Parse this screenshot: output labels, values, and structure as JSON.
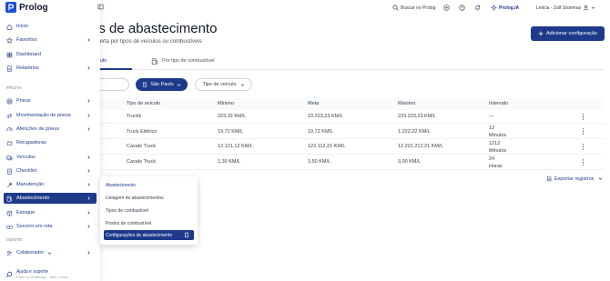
{
  "app": {
    "brand": "Prolog",
    "colors": {
      "primary": "#1e3a8a",
      "brand": "#1d4ed8",
      "text": "#1f2937",
      "muted": "#6b7280"
    }
  },
  "topbar": {
    "search_label": "Buscar no Prolog",
    "ia_label": "Prolog.IA",
    "user_label": "Leticia - Zalf Sistemas",
    "icons": [
      "search-icon",
      "add-circle-icon",
      "help-icon",
      "bell-icon",
      "sparkle-icon",
      "user-icon",
      "chevron-down-icon"
    ]
  },
  "sidebar": {
    "items_top": [
      {
        "label": "Início",
        "icon": "home-icon"
      },
      {
        "label": "Favoritos",
        "icon": "star-icon",
        "chevron": true
      },
      {
        "label": "Dashboard",
        "icon": "dashboard-icon"
      },
      {
        "label": "Relatórios",
        "icon": "report-icon",
        "chevron": true
      }
    ],
    "section_frota": "FROTA",
    "items_frota": [
      {
        "label": "Pneus",
        "icon": "tire-icon",
        "chevron": true
      },
      {
        "label": "Movimentação de pneus",
        "icon": "swap-icon",
        "chevron": true
      },
      {
        "label": "Aferições de pneus",
        "icon": "gauge-icon",
        "chevron": true
      },
      {
        "label": "Recapadoras",
        "icon": "recap-icon"
      },
      {
        "label": "Veículos",
        "icon": "truck-icon",
        "chevron": true
      },
      {
        "label": "Checklist",
        "icon": "checklist-icon",
        "chevron": true
      },
      {
        "label": "Manutenção",
        "icon": "wrench-icon",
        "chevron": true
      },
      {
        "label": "Abastecimento",
        "icon": "fuel-icon",
        "chevron": true,
        "active": true
      },
      {
        "label": "Estoque",
        "icon": "box-icon",
        "chevron": true
      },
      {
        "label": "Socorro em rota",
        "icon": "sos-icon",
        "chevron": true
      }
    ],
    "section_gente": "GENTE",
    "items_gente": [
      {
        "label": "Colaborador",
        "icon": "people-icon",
        "chevron": true
      }
    ],
    "help_title": "Ajuda e suporte",
    "help_sub": "Falar no whatsapp · Abrir o chat"
  },
  "flyout": {
    "heading": "Abastecimento",
    "items": [
      {
        "label": "Listagem de abastecimentos"
      },
      {
        "label": "Tipos de combustível"
      },
      {
        "label": "Postos de combustível"
      },
      {
        "label": "Configurações de abastecimento",
        "active": true
      }
    ]
  },
  "main": {
    "title": "es de abastecimento",
    "subtitle": "e alerta por tipos de veículos ou combustíveis",
    "add_button": "Adicionar configuração",
    "tabs": [
      "ulo",
      "Por tipo de combustível"
    ],
    "filters": {
      "unit": "São Paulo",
      "vehicle_type": "Tipo de veículo"
    },
    "table": {
      "headers": [
        "Tipo de veículo",
        "Mínimo",
        "Meta",
        "Máximo",
        "Intervalo"
      ],
      "rows": [
        [
          "Truckk",
          "223,32 KM/L",
          "23.223,23 KM/L",
          "233.223,23 KM/L",
          "---"
        ],
        [
          "Truck Elétrico",
          "19,72 KM/L",
          "19,72 KM/L",
          "1.222,22 KM/L",
          "12\nMinutos"
        ],
        [
          "Cavalo Truck",
          "12.121,12 KM/L",
          "122.112,21 KM/L",
          "12.221.212,21 KM/L",
          "1212\nMinutos"
        ],
        [
          "Cavalo Truck",
          "1,30 KM/L",
          "1,50 KM/L",
          "3,00 KM/L",
          "24\nHoras"
        ]
      ]
    },
    "export_label": "Exportar registros"
  }
}
